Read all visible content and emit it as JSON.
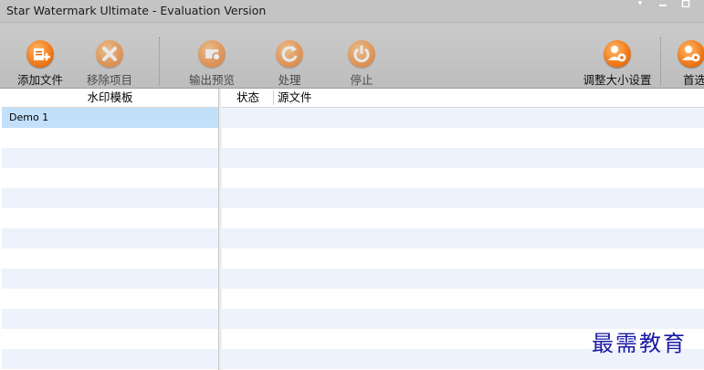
{
  "window": {
    "title": "Star Watermark Ultimate - Evaluation Version",
    "menu_glyph": "▾",
    "restore_glyph": "▫"
  },
  "toolbar": {
    "buttons": [
      {
        "label": "添加文件",
        "icon": "add-file-icon",
        "enabled": true
      },
      {
        "label": "移除项目",
        "icon": "remove-icon",
        "enabled": false
      },
      {
        "label": "输出预览",
        "icon": "preview-icon",
        "enabled": false
      },
      {
        "label": "处理",
        "icon": "process-icon",
        "enabled": false
      },
      {
        "label": "停止",
        "icon": "stop-icon",
        "enabled": false
      },
      {
        "label": "调整大小设置",
        "icon": "resize-settings-icon",
        "enabled": true
      },
      {
        "label": "首选",
        "icon": "preferences-icon",
        "enabled": true
      }
    ]
  },
  "templates": {
    "header": "水印模板",
    "items": [
      {
        "name": "Demo 1",
        "selected": true
      }
    ]
  },
  "files": {
    "columns": [
      "状态",
      "源文件"
    ]
  },
  "watermark_text": "最需教育",
  "colors": {
    "accent_orange": "#f07d1c",
    "selection": "#c3e0fb",
    "alt_row": "#edf3fc",
    "watermark": "#1a1aa6"
  }
}
